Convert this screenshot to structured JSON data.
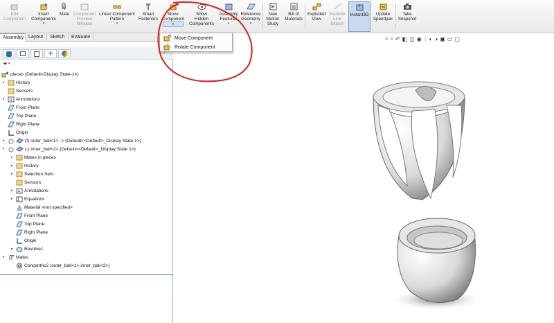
{
  "ribbon": {
    "edit_component": "Edit Component",
    "insert_components": "Insert Components",
    "mate": "Mate",
    "component_preview": "Component Preview Window",
    "linear_pattern": "Linear Component Pattern",
    "smart_fasteners": "Smart Fasteners",
    "move_component": "Move Component",
    "show_hidden": "Show Hidden Components",
    "assembly_features": "Assembly Features",
    "reference_geometry": "Reference Geometry",
    "new_motion_study": "New Motion Study",
    "bill_of_materials": "Bill of Materials",
    "exploded_view": "Exploded View",
    "explode_line_sketch": "Explode Line Sketch",
    "instant3d": "Instant3D",
    "update_speedpak": "Update Speedpak",
    "take_snapshot": "Take Snapshot"
  },
  "tabs": [
    "Assembly",
    "Layout",
    "Sketch",
    "Evaluate"
  ],
  "dropdown": {
    "move": "Move Component",
    "rotate": "Rotate Component"
  },
  "tree": {
    "root": "pieces  (Default<Display State-1>)",
    "history": "History",
    "sensors": "Sensors",
    "annotations": "Annotations",
    "front_plane": "Front Plane",
    "top_plane": "Top Plane",
    "right_plane": "Right Plane",
    "origin": "Origin",
    "outer_ball": "(f) outer_ball<1> -> (Default<<Default>_Display State 1>)",
    "inner_ball": "(-) inner_ball<2> (Default<<Default>_Display State 1>)",
    "mates_in_pieces": "Mates in pieces",
    "ib_history": "History",
    "selection_sets": "Selection Sets",
    "ib_sensors": "Sensors",
    "ib_annotations": "Annotations",
    "equations": "Equations",
    "material": "Material <not specified>",
    "ib_front_plane": "Front Plane",
    "ib_top_plane": "Top Plane",
    "ib_right_plane": "Right Plane",
    "ib_origin": "Origin",
    "revolve1": "Revolve1",
    "mates": "Mates",
    "concentric2": "Concentric2 (outer_ball<1>,inner_ball<2>)"
  },
  "colors": {
    "accent": "#3d73c2",
    "annotation_circle": "#d42020",
    "selected_tool": "#c9d9ee"
  }
}
